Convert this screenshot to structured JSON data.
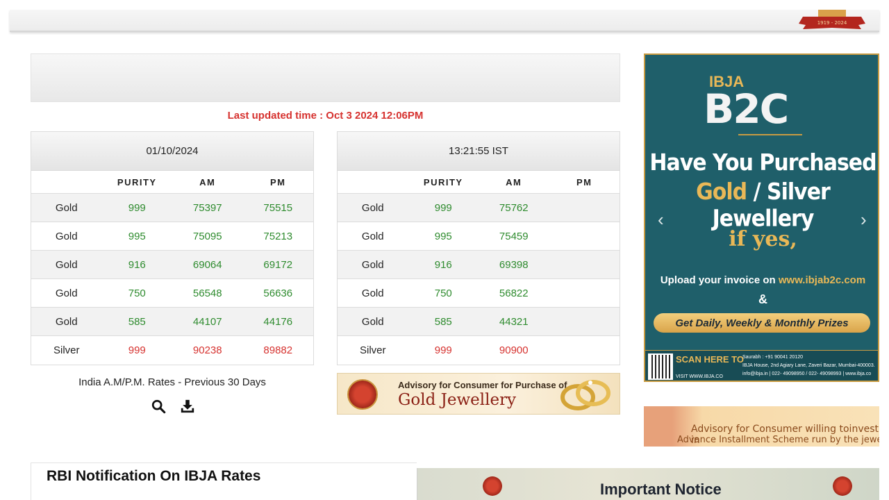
{
  "header": {
    "emblem_text": "1919 - 2024"
  },
  "last_updated": "Last updated time : Oct 3 2024 12:06PM",
  "tables": [
    {
      "heading": "01/10/2024",
      "columns": [
        "",
        "PURITY",
        "AM",
        "PM"
      ],
      "rows": [
        {
          "metal": "Gold",
          "purity": "999",
          "am": "75397",
          "pm": "75515",
          "kind": "gold"
        },
        {
          "metal": "Gold",
          "purity": "995",
          "am": "75095",
          "pm": "75213",
          "kind": "gold"
        },
        {
          "metal": "Gold",
          "purity": "916",
          "am": "69064",
          "pm": "69172",
          "kind": "gold"
        },
        {
          "metal": "Gold",
          "purity": "750",
          "am": "56548",
          "pm": "56636",
          "kind": "gold"
        },
        {
          "metal": "Gold",
          "purity": "585",
          "am": "44107",
          "pm": "44176",
          "kind": "gold"
        },
        {
          "metal": "Silver",
          "purity": "999",
          "am": "90238",
          "pm": "89882",
          "kind": "silver"
        }
      ]
    },
    {
      "heading": "13:21:55 IST",
      "columns": [
        "",
        "PURITY",
        "AM",
        "PM"
      ],
      "rows": [
        {
          "metal": "Gold",
          "purity": "999",
          "am": "75762",
          "pm": "",
          "kind": "gold"
        },
        {
          "metal": "Gold",
          "purity": "995",
          "am": "75459",
          "pm": "",
          "kind": "gold"
        },
        {
          "metal": "Gold",
          "purity": "916",
          "am": "69398",
          "pm": "",
          "kind": "gold"
        },
        {
          "metal": "Gold",
          "purity": "750",
          "am": "56822",
          "pm": "",
          "kind": "gold"
        },
        {
          "metal": "Gold",
          "purity": "585",
          "am": "44321",
          "pm": "",
          "kind": "gold"
        },
        {
          "metal": "Silver",
          "purity": "999",
          "am": "90900",
          "pm": "",
          "kind": "silver"
        }
      ]
    }
  ],
  "previous_rates": {
    "label": "India A.M/P.M. Rates - Previous 30 Days",
    "icons": [
      "search-icon",
      "download-icon"
    ]
  },
  "advisory_banner": {
    "line1": "Advisory for Consumer for Purchase of",
    "line2": "Gold Jewellery"
  },
  "b2c_banner": {
    "brand_top": "IBJA",
    "brand_main": "B2C",
    "headline1": "Have You Purchased",
    "headline2_gold": "Gold",
    "headline2_rest": " / Silver Jewellery",
    "headline3": "if yes,",
    "upload_text": "Upload your invoice on ",
    "upload_link": "www.ibjab2c.com",
    "amp": "&",
    "prizes": "Get Daily, Weekly & Monthly Prizes",
    "scan": "SCAN HERE TO",
    "visit": "VISIT WWW.IBJA.CO",
    "contact_line1": "Saurabh : +91 90041 20120",
    "contact_line2": "IBJA House, 2nd Agiary Lane, Zaveri Bazar, Mumbai-400003.",
    "contact_line3": "info@ibja.in | 022- 49098950 / 022- 49098993 | www.ibja.co",
    "prev_arrow": "‹",
    "next_arrow": "›"
  },
  "installment_banner": {
    "line1": "Advisory for Consumer willing toinvest in",
    "line2": "Advance Installment Scheme run by the jewelle"
  },
  "rbi_section": {
    "title": "RBI Notification On IBJA Rates"
  },
  "notice_banner": {
    "title": "Important Notice"
  },
  "colors": {
    "accent_red": "#d6322f",
    "rate_green": "#2e8b2e",
    "banner_teal": "#1f5f6a",
    "banner_gold": "#e9b857"
  }
}
